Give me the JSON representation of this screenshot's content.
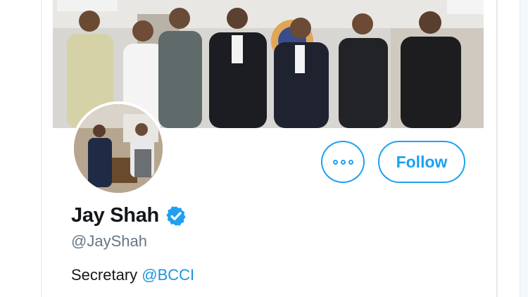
{
  "profile": {
    "display_name": "Jay Shah",
    "verified_icon": "verified-badge-icon",
    "handle": "@JayShah",
    "bio_text": "Secretary ",
    "bio_mention": "@BCCI"
  },
  "actions": {
    "more_icon": "more-options-icon",
    "follow_label": "Follow"
  },
  "colors": {
    "accent": "#1da1f2",
    "text_primary": "#14171a",
    "text_secondary": "#657786",
    "mention": "#1b95e0"
  }
}
